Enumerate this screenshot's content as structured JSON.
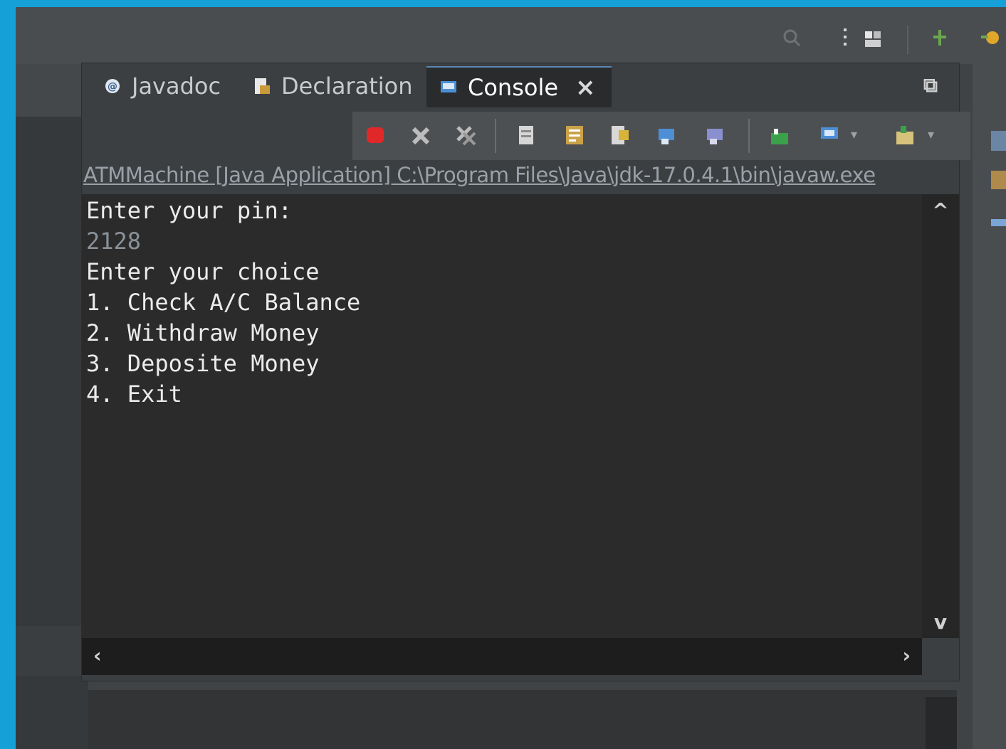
{
  "tabs": [
    {
      "label": "Javadoc",
      "icon": "javadoc-icon",
      "active": false
    },
    {
      "label": "Declaration",
      "icon": "declaration-icon",
      "active": false
    },
    {
      "label": "Console",
      "icon": "console-icon",
      "active": true
    }
  ],
  "console": {
    "launch_label": "ATMMachine [Java Application] C:\\Program Files\\Java\\jdk-17.0.4.1\\bin\\javaw.exe",
    "lines": [
      {
        "text": "Enter your pin:",
        "type": "output"
      },
      {
        "text": "2128",
        "type": "input"
      },
      {
        "text": "Enter your choice",
        "type": "output"
      },
      {
        "text": "1. Check A/C Balance",
        "type": "output"
      },
      {
        "text": "2. Withdraw Money",
        "type": "output"
      },
      {
        "text": "3. Deposite Money",
        "type": "output"
      },
      {
        "text": "4. Exit",
        "type": "output"
      }
    ]
  },
  "view_toolbar_icons": [
    "terminate-icon",
    "remove-launch-icon",
    "remove-all-terminated-icon",
    "scroll-lock-icon",
    "word-wrap-icon",
    "show-on-output-icon",
    "show-on-error-icon",
    "pin-console-icon",
    "new-console-icon",
    "display-console-icon",
    "open-console-icon"
  ],
  "top_toolbar_icons": [
    "search-icon",
    "toolbar-grip-icon",
    "perspective-icon",
    "java-perspective-icon",
    "debug-perspective-icon"
  ],
  "colors": {
    "background": "#16a0d8",
    "console_bg": "#2b2b2b",
    "console_text": "#ebebeb",
    "input_text": "#8a9199",
    "terminate": "#e02828"
  }
}
